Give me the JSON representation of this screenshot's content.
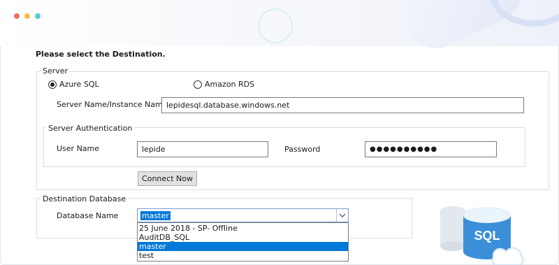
{
  "window": {
    "dots": [
      {
        "name": "window-dot-red",
        "color": "#f0705a"
      },
      {
        "name": "window-dot-yellow",
        "color": "#f5bd4f"
      },
      {
        "name": "window-dot-blue",
        "color": "#5cc7d9"
      }
    ]
  },
  "heading": "Please select the Destination.",
  "server": {
    "legend": "Server",
    "radio_azure": "Azure SQL",
    "radio_amazon": "Amazon RDS",
    "selected": "Azure SQL",
    "instance_label": "Server Name/Instance Name",
    "instance_value": "lepidesql.database.windows.net"
  },
  "auth": {
    "legend": "Server Authentication",
    "user_label": "User Name",
    "user_value": "lepide",
    "password_label": "Password",
    "password_value": "●●●●●●●●●●"
  },
  "connect_button": "Connect Now",
  "destination": {
    "legend": "Destination Database",
    "db_label": "Database Name",
    "db_selected": "master",
    "options": [
      "25 June 2018 - SP- Offline",
      "AuditDB_SQL",
      "master",
      "test"
    ],
    "highlighted_index": 2
  },
  "illustration": {
    "text": "SQL",
    "colors": {
      "accent": "#3a8fd8",
      "light": "#cfe3f6"
    }
  }
}
